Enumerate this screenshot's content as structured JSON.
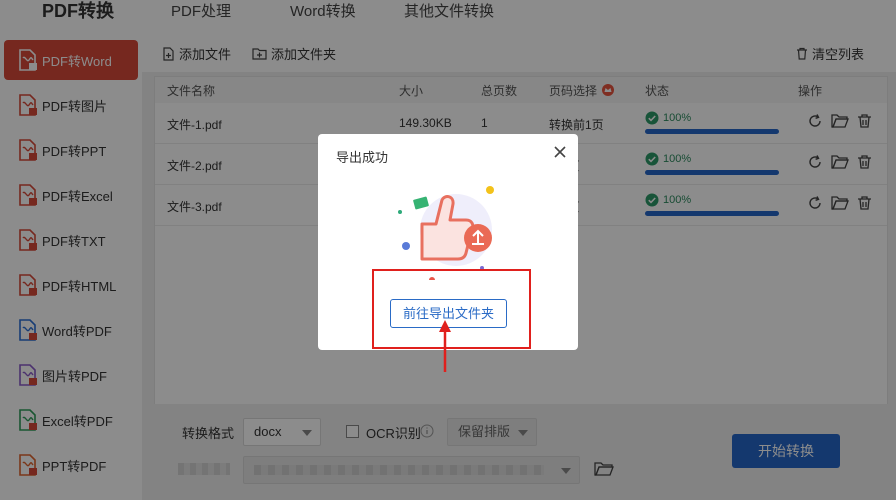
{
  "app": {
    "logo": "PDF转换"
  },
  "topnav": [
    {
      "label": "PDF处理"
    },
    {
      "label": "Word转换"
    },
    {
      "label": "其他文件转换"
    }
  ],
  "sidebar": {
    "items": [
      {
        "label": "PDF转Word",
        "icon": "pdf-word-icon",
        "color": "#d84a3a"
      },
      {
        "label": "PDF转图片",
        "icon": "pdf-image-icon",
        "color": "#d84a3a"
      },
      {
        "label": "PDF转PPT",
        "icon": "pdf-ppt-icon",
        "color": "#d84a3a"
      },
      {
        "label": "PDF转Excel",
        "icon": "pdf-excel-icon",
        "color": "#d84a3a"
      },
      {
        "label": "PDF转TXT",
        "icon": "pdf-txt-icon",
        "color": "#d84a3a"
      },
      {
        "label": "PDF转HTML",
        "icon": "pdf-html-icon",
        "color": "#d84a3a"
      },
      {
        "label": "Word转PDF",
        "icon": "word-pdf-icon",
        "color": "#2b6fd6"
      },
      {
        "label": "图片转PDF",
        "icon": "image-pdf-icon",
        "color": "#8a5cc8"
      },
      {
        "label": "Excel转PDF",
        "icon": "excel-pdf-icon",
        "color": "#2e9d5a"
      },
      {
        "label": "PPT转PDF",
        "icon": "ppt-pdf-icon",
        "color": "#e0642e"
      }
    ],
    "active_index": 0
  },
  "toolbar": {
    "add_file": "添加文件",
    "add_folder": "添加文件夹",
    "clear_list": "清空列表"
  },
  "table": {
    "headers": {
      "name": "文件名称",
      "size": "大小",
      "pages": "总页数",
      "page_select": "页码选择",
      "status": "状态",
      "ops": "操作"
    },
    "rows": [
      {
        "name": "文件-1.pdf",
        "size": "149.30KB",
        "pages": "1",
        "page_select": "转换前1页",
        "progress": "100%"
      },
      {
        "name": "文件-2.pdf",
        "size": "",
        "pages": "",
        "page_select": "前1页",
        "progress": "100%"
      },
      {
        "name": "文件-3.pdf",
        "size": "",
        "pages": "",
        "page_select": "前1页",
        "progress": "100%"
      }
    ]
  },
  "bottom": {
    "format_label": "转换格式",
    "format_value": "docx",
    "ocr_label": "OCR识别",
    "layout_value": "保留排版",
    "start_button": "开始转换"
  },
  "dialog": {
    "title": "导出成功",
    "goto_button": "前往导出文件夹"
  },
  "colors": {
    "accent_red": "#d84a3a",
    "primary_blue": "#2566c8",
    "success_green": "#2d8b5f",
    "highlight_red": "#e0201d"
  }
}
